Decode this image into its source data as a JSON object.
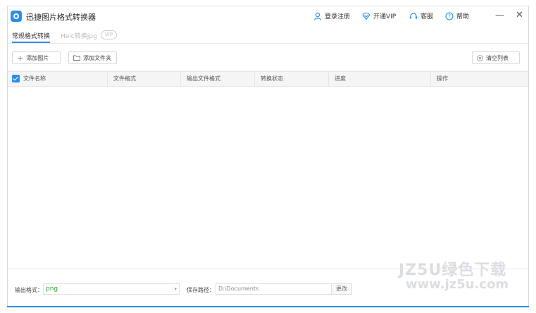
{
  "app": {
    "title": "迅捷图片格式转换器"
  },
  "titlebar": {
    "login": "登录注册",
    "vip": "开通VIP",
    "service": "客服",
    "help": "帮助",
    "minimize": "—",
    "close": "✕"
  },
  "tabs": [
    {
      "label": "常规格式转换",
      "active": true
    },
    {
      "label": "Heic转换jpg",
      "active": false
    }
  ],
  "vip_badge": "VIP",
  "toolbar": {
    "add_image": "添加图片",
    "add_folder": "添加文件夹",
    "clear_list": "清空列表"
  },
  "table": {
    "columns": [
      "文件名称",
      "文件格式",
      "输出文件格式",
      "转换状态",
      "进度",
      "操作"
    ],
    "select_all_checked": true,
    "rows": []
  },
  "footer": {
    "output_format_label": "输出格式：",
    "output_format_value": "png",
    "save_path_label": "保存路径：",
    "save_path_value": "D:\\Documents",
    "change_button": "更改"
  },
  "watermark": {
    "line1": "JZ5U绿色下载",
    "line2": "www.jz5u.com"
  },
  "colors": {
    "accent": "#2a8ee6",
    "format_value": "#2ca02c"
  }
}
